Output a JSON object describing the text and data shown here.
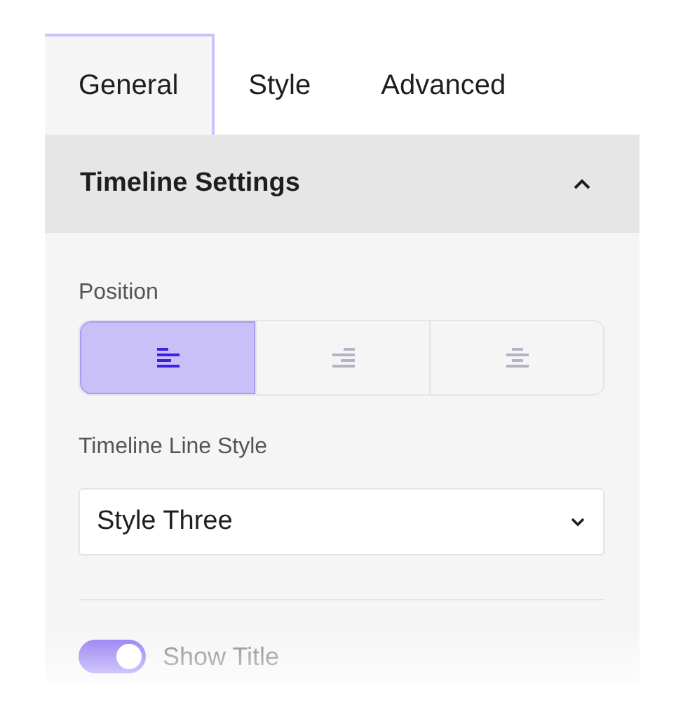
{
  "tabs": [
    {
      "label": "General",
      "selected": true
    },
    {
      "label": "Style",
      "selected": false
    },
    {
      "label": "Advanced",
      "selected": false
    }
  ],
  "section": {
    "title": "Timeline Settings",
    "expanded": true
  },
  "position": {
    "label": "Position",
    "options": [
      {
        "kind": "left",
        "selected": true
      },
      {
        "kind": "right",
        "selected": false
      },
      {
        "kind": "center",
        "selected": false
      }
    ]
  },
  "line_style": {
    "label": "Timeline Line Style",
    "value": "Style Three"
  },
  "show_title": {
    "label": "Show Title",
    "on": true
  }
}
